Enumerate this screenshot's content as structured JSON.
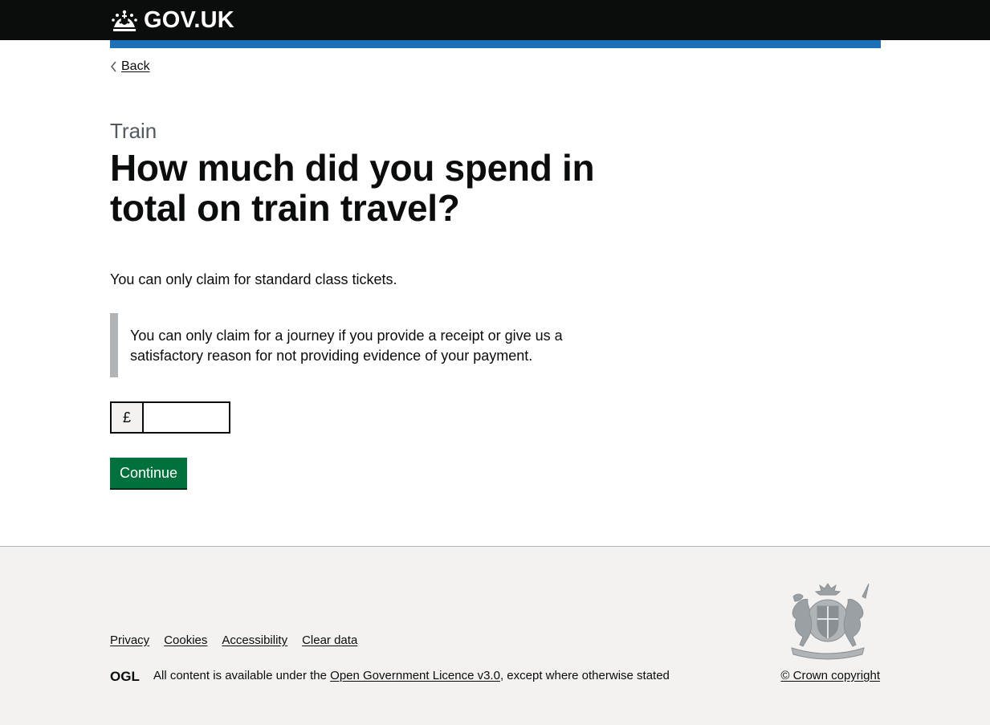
{
  "header": {
    "logo_text": "GOV.UK",
    "logo_icon": "crown-icon",
    "accent_color": "#1d70b8"
  },
  "back_link": {
    "label": "Back"
  },
  "question": {
    "caption": "Train",
    "heading": "How much did you spend in total on train travel?",
    "hint": "You can only claim for standard class tickets.",
    "inset": "You can only claim for a journey if you provide a receipt or give us a satisfactory reason for not providing evidence of your payment."
  },
  "amount_field": {
    "prefix": "£",
    "value": ""
  },
  "continue_button": {
    "label": "Continue",
    "color": "#00703c"
  },
  "footer": {
    "links": [
      "Privacy",
      "Cookies",
      "Accessibility",
      "Clear data"
    ],
    "licence_prefix": "All content is available under the",
    "licence_link": "Open Government Licence v3.0",
    "licence_suffix": ", except where otherwise stated",
    "ogl_logo": "OGL",
    "crest_icon": "royal-coat-of-arms-icon",
    "copyright": "© Crown copyright"
  }
}
